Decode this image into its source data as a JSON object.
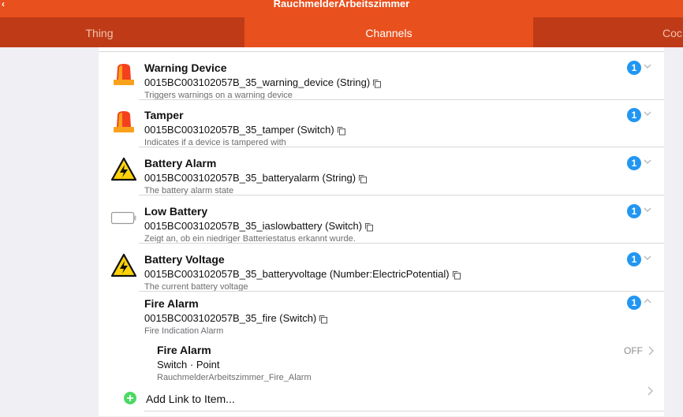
{
  "window": {
    "title": "RauchmelderArbeitszimmer",
    "back_glyph": "‹"
  },
  "tabs": [
    {
      "label": "Thing"
    },
    {
      "label": "Channels"
    },
    {
      "label": "Coc"
    }
  ],
  "channels": [
    {
      "title": "Warning Device",
      "uid": "0015BC003102057B_35_warning_device (String)",
      "description": "Triggers warnings on a warning device",
      "badge": "1",
      "icon": "siren-icon"
    },
    {
      "title": "Tamper",
      "uid": "0015BC003102057B_35_tamper (Switch)",
      "description": "Indicates if a device is tampered with",
      "badge": "1",
      "icon": "siren-icon"
    },
    {
      "title": "Battery Alarm",
      "uid": "0015BC003102057B_35_batteryalarm (String)",
      "description": "The battery alarm state",
      "badge": "1",
      "icon": "warning-triangle-icon"
    },
    {
      "title": "Low Battery",
      "uid": "0015BC003102057B_35_iaslowbattery (Switch)",
      "description": "Zeigt an, ob ein niedriger Batteriestatus erkannt wurde.",
      "badge": "1",
      "icon": "battery-icon"
    },
    {
      "title": "Battery Voltage",
      "uid": "0015BC003102057B_35_batteryvoltage (Number:ElectricPotential)",
      "description": "The current battery voltage",
      "badge": "1",
      "icon": "warning-triangle-icon"
    },
    {
      "title": "Fire Alarm",
      "uid": "0015BC003102057B_35_fire (Switch)",
      "description": "Fire Indication Alarm",
      "badge": "1",
      "icon": "none",
      "expanded": true
    }
  ],
  "linked_item": {
    "title": "Fire Alarm",
    "type": "Switch · Point",
    "name": "RauchmelderArbeitszimmer_Fire_Alarm",
    "state": "OFF"
  },
  "add_link": {
    "label": "Add Link to Item..."
  },
  "colors": {
    "accent": "#e8501e",
    "tab_bar": "#bf3b17",
    "badge": "#2196f3",
    "add_green": "#4cd964"
  }
}
